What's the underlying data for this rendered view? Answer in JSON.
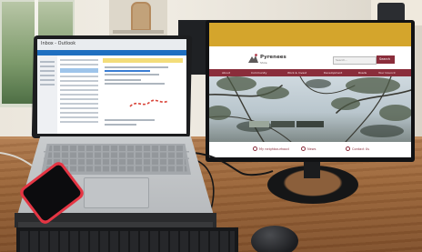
{
  "scene": {
    "description_colors": {
      "table": "#9a6539",
      "phone_case": "#e43543",
      "site_accent": "#8a2d3b",
      "notice_banner": "#d4a52c"
    }
  },
  "laptop_screen": {
    "app": "Outlook",
    "ribbon_title": "Inbox - Outlook"
  },
  "website": {
    "notice_lines": [
      "",
      "",
      ""
    ],
    "logo_name": "Pyrenees",
    "logo_sub": "Shire",
    "search_placeholder": "Search...",
    "search_button": "Search",
    "nav_items": [
      "About",
      "Community",
      "Work & Invest",
      "Development",
      "Roads",
      "Your Council"
    ],
    "hero_tabs": [
      "",
      "",
      ""
    ],
    "footer_items": [
      "My neighbourhood",
      "News",
      "Contact Us"
    ]
  }
}
